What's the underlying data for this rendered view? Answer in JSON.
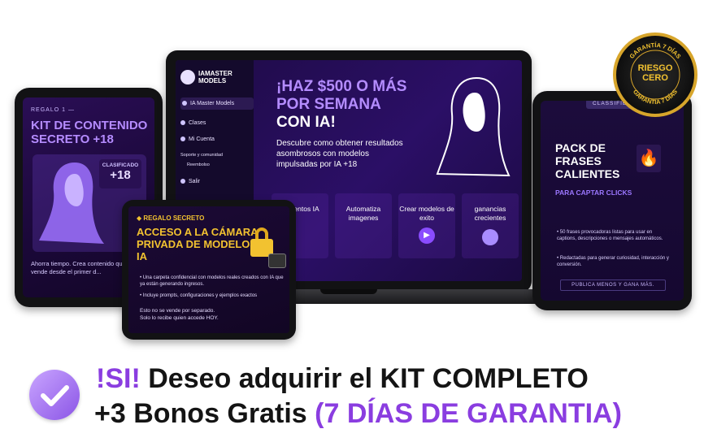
{
  "laptop": {
    "brand_line1": "IAMASTER",
    "brand_line2": "MODELS",
    "menu": [
      "IA Master Models",
      "Clases",
      "Mi Cuenta",
      "Soporte y comunidad",
      "Reembolso",
      "Salir"
    ],
    "hero_title": "¡HAZ $500 O MÁS POR SEMANA",
    "hero_title2": "CON IA!",
    "hero_sub": "Descubre como obtener resultados asombrosos con modelos impulsadas por IA +18",
    "features": [
      "...mientos IA",
      "Automatiza imagenes",
      "Crear modelos de exito",
      "ganancias crecientes"
    ]
  },
  "tablet_left": {
    "label": "REGALO 1 —",
    "title": "KIT DE CONTENIDO SECRETO +18",
    "badge_line1": "CLASIFICADO",
    "badge_line2": "+18",
    "text": "Ahorra tiempo. Crea contenido que vende desde el primer d..."
  },
  "tablet_front": {
    "label": "REGALO SECRETO",
    "title": "ACCESO A LA CÁMARA PRIVADA DE MODELOS IA",
    "bullets": [
      "Una carpeta confidencial con modelos reales creados con IA que ya están generando ingresos.",
      "Incluye prompts, configuraciones y ejemplos exactos"
    ],
    "footer_line1": "Esto no se vende por separado.",
    "footer_line2": "Solo lo recibe quien accede HOY."
  },
  "tablet_right": {
    "tag": "CLASSIFIED",
    "title": "PACK DE FRASES CALIENTES",
    "subtitle": "PARA CAPTAR CLICKS",
    "bullets": [
      "50 frases provocadoras listas para usar en captions, descripciones o mensajes automáticos.",
      "Redactadas para generar curiosidad, interacción y conversión."
    ],
    "footer": "PUBLICA MENOS Y GANA MÁS."
  },
  "seal": {
    "top_text": "GARANTÍA 7 DÍAS",
    "line1": "RIESGO",
    "line2": "CERO",
    "bottom_text": "GARANTÍA 7 DÍAS"
  },
  "cta": {
    "part1": "!SI!",
    "part2": " Deseo adquirir el KIT COMPLETO",
    "part3": "+3 Bonos Gratis ",
    "part4": "(7 DÍAS DE GARANTIA)"
  },
  "colors": {
    "accent_purple": "#8a3de0",
    "gold": "#f2c230",
    "dark": "#141414"
  }
}
